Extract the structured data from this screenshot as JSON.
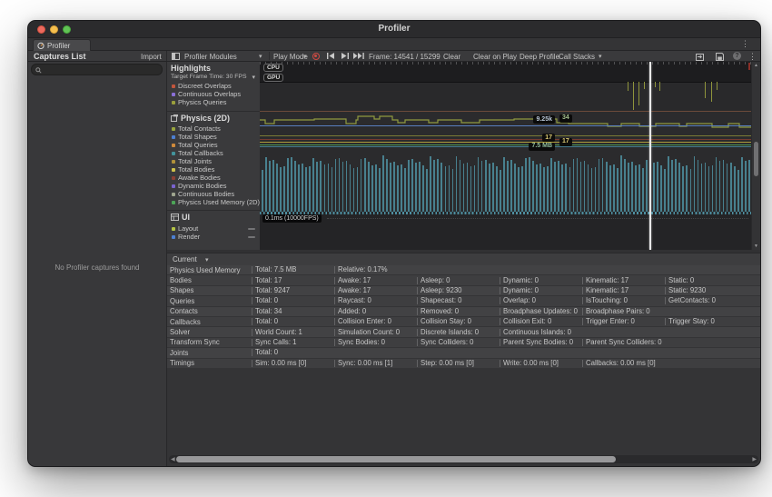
{
  "window": {
    "title": "Profiler"
  },
  "tab_bar": {
    "tab": "Profiler"
  },
  "toolbar": {
    "captures_title": "Captures List",
    "import": "Import",
    "profiler_modules": "Profiler Modules",
    "play_mode": "Play Mode",
    "frame_info": "Frame: 14541 / 15299",
    "clear": "Clear",
    "clear_on_play": "Clear on Play",
    "deep_profile": "Deep Profile",
    "call_stacks": "Call Stacks"
  },
  "captures_panel": {
    "empty_message": "No Profiler captures found"
  },
  "modules": {
    "highlights": {
      "title": "Highlights",
      "target_fps": "Target Frame Time: 30 FPS",
      "legend": [
        {
          "label": "Discreet Overlaps",
          "color": "#c2563d"
        },
        {
          "label": "Continuous Overlaps",
          "color": "#8a6fd8"
        },
        {
          "label": "Physics Queries",
          "color": "#9a9f3c"
        }
      ]
    },
    "physics": {
      "title": "Physics (2D)",
      "legend": [
        {
          "label": "Total Contacts",
          "color": "#9aa63e"
        },
        {
          "label": "Total Shapes",
          "color": "#4d80d2"
        },
        {
          "label": "Total Queries",
          "color": "#cf8a3b"
        },
        {
          "label": "Total Callbacks",
          "color": "#42939b"
        },
        {
          "label": "Total Joints",
          "color": "#b1913a"
        },
        {
          "label": "Total Bodies",
          "color": "#cfc24a"
        },
        {
          "label": "Awake Bodies",
          "color": "#8a4035"
        },
        {
          "label": "Dynamic Bodies",
          "color": "#7a63cf"
        },
        {
          "label": "Continuous Bodies",
          "color": "#9fa58f"
        },
        {
          "label": "Physics Used Memory (2D)",
          "color": "#4da457"
        }
      ]
    },
    "ui": {
      "title": "UI",
      "legend": [
        {
          "label": "Layout",
          "color": "#b3c245"
        },
        {
          "label": "Render",
          "color": "#4d80d2"
        }
      ]
    }
  },
  "chart": {
    "cpu_badge": "CPU",
    "gpu_badge": "GPU",
    "markers": {
      "shapes": "9.25k",
      "contacts": "34",
      "kinematic": "17",
      "bodies": "17",
      "memory": "7.5 MB"
    },
    "marker_colors": {
      "shapes": "#b9c7d8",
      "contacts": "#a4c08e",
      "kinematic": "#d9c873",
      "bodies": "#d9c873",
      "memory": "#93bf9e"
    },
    "ui_scale": "0.1ms (10000FPS)",
    "colors": {
      "bars": "#4e8fa0",
      "contacts_line": "#8f9a40",
      "shapes_line": "#5b84c6",
      "queries_spikes": "#8f943c",
      "joints_line": "#7f7f36",
      "awake_line": "#7a3b30",
      "bodies_line": "#b3a03c",
      "memory_line": "#4e9a55",
      "callbacks_line": "#447f95",
      "target_line": "#6b4a3a",
      "highlight_marker": "#8a2f28"
    }
  },
  "details": {
    "mode": "Current",
    "rows": [
      {
        "label": "Physics Used Memory",
        "cells": [
          "Total: 7.5 MB",
          "Relative: 0.17%"
        ]
      },
      {
        "label": "Bodies",
        "cells": [
          "Total: 17",
          "Awake: 17",
          "Asleep: 0",
          "Dynamic: 0",
          "Kinematic: 17",
          "Static: 0"
        ]
      },
      {
        "label": "Shapes",
        "cells": [
          "Total: 9247",
          "Awake: 17",
          "Asleep: 9230",
          "Dynamic: 0",
          "Kinematic: 17",
          "Static: 9230"
        ]
      },
      {
        "label": "Queries",
        "cells": [
          "Total: 0",
          "Raycast: 0",
          "Shapecast: 0",
          "Overlap: 0",
          "IsTouching: 0",
          "GetContacts: 0"
        ]
      },
      {
        "label": "Contacts",
        "cells": [
          "Total: 34",
          "Added: 0",
          "Removed: 0",
          "Broadphase Updates: 0",
          "Broadphase Pairs: 0"
        ]
      },
      {
        "label": "Callbacks",
        "cells": [
          "Total: 0",
          "Collision Enter: 0",
          "Collision Stay: 0",
          "Collision Exit: 0",
          "Trigger Enter: 0",
          "Trigger Stay: 0"
        ]
      },
      {
        "label": "Solver",
        "cells": [
          "World Count: 1",
          "Simulation Count: 0",
          "Discrete Islands: 0",
          "Continuous Islands: 0"
        ]
      },
      {
        "label": "Transform Sync",
        "cells": [
          "Sync Calls: 1",
          "Sync Bodies: 0",
          "Sync Colliders: 0",
          "Parent Sync Bodies: 0",
          "Parent Sync Colliders: 0"
        ]
      },
      {
        "label": "Joints",
        "cells": [
          "Total: 0"
        ]
      },
      {
        "label": "Timings",
        "cells": [
          "Sim: 0.00 ms [0]",
          "Sync: 0.00 ms [1]",
          "Step: 0.00 ms [0]",
          "Write: 0.00 ms [0]",
          "Callbacks: 0.00 ms [0]"
        ]
      }
    ]
  }
}
